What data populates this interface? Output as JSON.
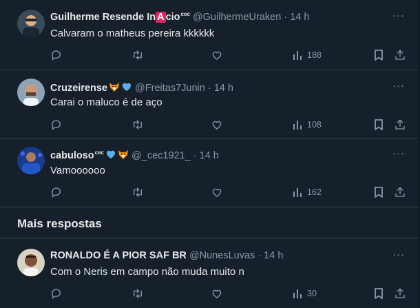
{
  "tweets": [
    {
      "name": "Guilherme Resende In",
      "name_red": "A",
      "name_after": "cio",
      "badge": "cec",
      "handle": "@GuilhermeUraken",
      "sep": "·",
      "time": "14 h",
      "text": "Calvaram o matheus pereira kkkkkk",
      "views": "188"
    },
    {
      "name": "Cruzeirense",
      "handle": "@Freitas7Junin",
      "sep": "·",
      "time": "14 h",
      "text": "Carai o maluco é de aço",
      "views": "108"
    },
    {
      "name": "cabuloso",
      "badge": "cec",
      "handle": "@_cec1921_",
      "sep": "·",
      "time": "14 h",
      "text": "Vamoooooo",
      "views": "162"
    },
    {
      "name": "RONALDO É A PIOR SAF BR",
      "handle": "@NunesLuvas",
      "sep": "·",
      "time": "14 h",
      "text": "Com o Neris em campo não muda muito n",
      "views": "30"
    }
  ],
  "section": {
    "more_replies": "Mais respostas"
  },
  "more_label": "···",
  "icons": [
    "reply-icon",
    "retweet-icon",
    "like-icon",
    "views-icon",
    "bookmark-icon",
    "share-icon",
    "fox-emoji-icon",
    "blue-heart-emoji-icon"
  ],
  "colors": {
    "background": "#15202b",
    "text": "#e7e9ea",
    "muted": "#8b98a5",
    "divider": "#38444d",
    "heart_blue": "#5dadec"
  }
}
